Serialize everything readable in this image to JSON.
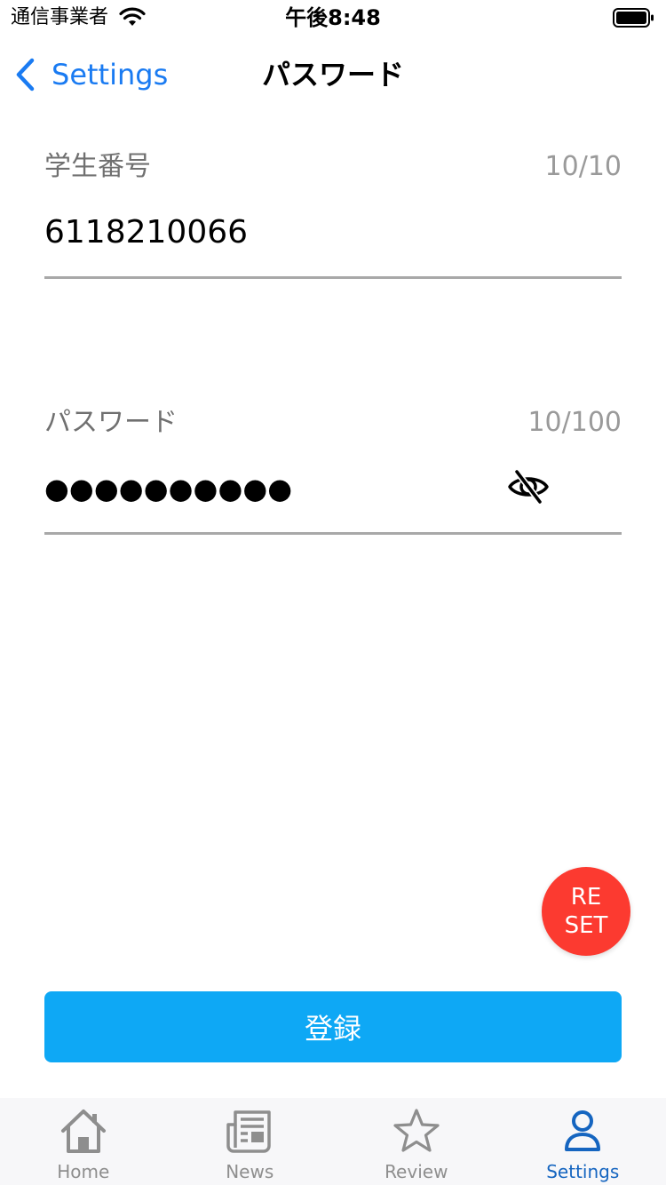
{
  "status_bar": {
    "carrier": "通信事業者",
    "time": "午後8:48"
  },
  "nav": {
    "back_label": "Settings",
    "title": "パスワード"
  },
  "student_field": {
    "label": "学生番号",
    "counter": "10/10",
    "value": "6118210066"
  },
  "password_field": {
    "label": "パスワード",
    "counter": "10/100",
    "masked_value": "●●●●●●●●●●",
    "visibility_icon": "eye-off-icon"
  },
  "reset_button": {
    "line1": "RE",
    "line2": "SET",
    "color": "#fc3a30"
  },
  "register_button": {
    "label": "登録",
    "color": "#0ea8f5"
  },
  "tab_bar": {
    "tabs": [
      {
        "label": "Home",
        "icon": "home-icon",
        "active": false
      },
      {
        "label": "News",
        "icon": "newspaper-icon",
        "active": false
      },
      {
        "label": "Review",
        "icon": "star-icon",
        "active": false
      },
      {
        "label": "Settings",
        "icon": "person-icon",
        "active": true
      }
    ],
    "active_color": "#1565c0",
    "inactive_color": "#8e8e8e"
  },
  "colors": {
    "accent": "#1a7bf2"
  }
}
